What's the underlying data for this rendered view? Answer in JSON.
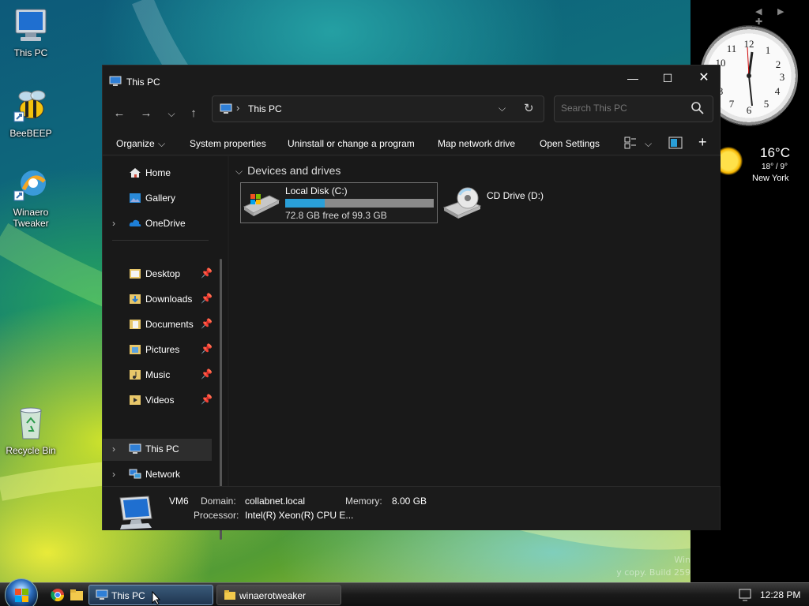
{
  "desktop": {
    "icons": [
      {
        "label": "This PC"
      },
      {
        "label": "BeeBEEP"
      },
      {
        "label": "Winaero Tweaker"
      },
      {
        "label": "Recycle Bin"
      }
    ],
    "watermark_line1": "Win",
    "watermark_line2": "y copy. Build 259"
  },
  "weather": {
    "temp": "16°C",
    "range": "18° / 9°",
    "city": "New York"
  },
  "window": {
    "title": "This PC",
    "address": {
      "location": "This PC"
    },
    "search": {
      "placeholder": "Search This PC"
    },
    "commands": {
      "organize": "Organize",
      "system_properties": "System properties",
      "uninstall": "Uninstall or change a program",
      "map_drive": "Map network drive",
      "open_settings": "Open Settings"
    },
    "nav": {
      "items": [
        {
          "label": "Home"
        },
        {
          "label": "Gallery"
        },
        {
          "label": "OneDrive"
        },
        {
          "label": "Desktop"
        },
        {
          "label": "Downloads"
        },
        {
          "label": "Documents"
        },
        {
          "label": "Pictures"
        },
        {
          "label": "Music"
        },
        {
          "label": "Videos"
        },
        {
          "label": "This PC"
        },
        {
          "label": "Network"
        }
      ]
    },
    "content": {
      "group_header": "Devices and drives",
      "drives": [
        {
          "name": "Local Disk (C:)",
          "free_text": "72.8 GB free of 99.3 GB",
          "used_fraction": 0.267
        },
        {
          "name": "CD Drive (D:)"
        }
      ]
    },
    "details": {
      "computer_name": "VM6",
      "domain_label": "Domain:",
      "domain_value": "collabnet.local",
      "memory_label": "Memory:",
      "memory_value": "8.00 GB",
      "processor_label": "Processor:",
      "processor_value": "Intel(R) Xeon(R) CPU E..."
    }
  },
  "taskbar": {
    "tasks": [
      {
        "label": "This PC"
      },
      {
        "label": "winaerotweaker"
      }
    ],
    "time": "12:28 PM"
  },
  "colors": {
    "accent": "#2a9fd8",
    "window_bg": "#191919",
    "pin": "#4aa3e0"
  }
}
